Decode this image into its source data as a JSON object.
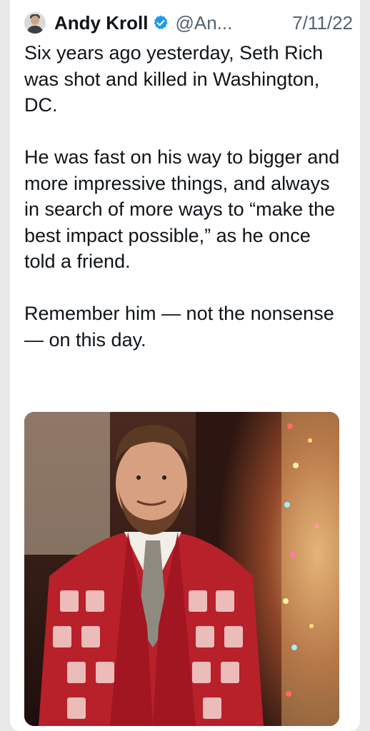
{
  "tweet": {
    "author_name": "Andy Kroll",
    "handle": "@An...",
    "date": "7/11/22",
    "paragraphs": [
      "Six years ago yesterday, Seth Rich was shot and killed in Washington, DC.",
      "He was fast on his way to bigger and more impressive things, and always in search of more ways to “make the best impact possible,” as he once told a friend.",
      "Remember him — not the nonsense — on this day."
    ],
    "icons": {
      "avatar": "avatar-photo",
      "verified": "verified-badge-icon"
    },
    "colors": {
      "verified": "#1d9bf0",
      "text": "#0f1419",
      "muted": "#536471"
    },
    "media": {
      "type": "photo"
    }
  }
}
